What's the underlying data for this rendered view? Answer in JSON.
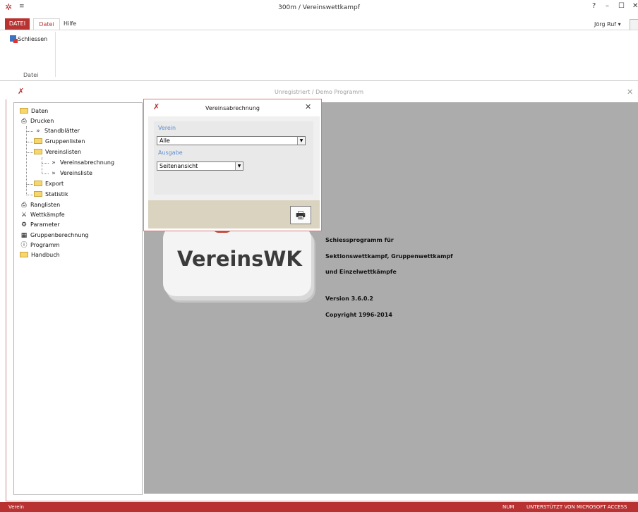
{
  "window": {
    "title": "300m / Vereinswettkampf",
    "controls": {
      "help": "?",
      "minimize": "–",
      "maximize": "☐",
      "close": "✕"
    },
    "qat": "≡"
  },
  "ribbon": {
    "tab_backstage": "DATEI",
    "tab_datei": "Datei",
    "tab_hilfe": "Hilfe",
    "user": "Jörg Ruf ▾",
    "schliessen_label": "Schliessen",
    "group_label": "Datei"
  },
  "document": {
    "status": "Unregistriert  /  Demo Programm",
    "close": "✕"
  },
  "nav": {
    "daten": "Daten",
    "drucken": "Drucken",
    "standblaetter": "Standblätter",
    "gruppenlisten": "Gruppenlisten",
    "vereinslisten": "Vereinslisten",
    "vereinsabrechnung": "Vereinsabrechnung",
    "vereinsliste": "Vereinsliste",
    "export": "Export",
    "statistik": "Statistik",
    "ranglisten": "Ranglisten",
    "wettkaempfe": "Wettkämpfe",
    "parameter": "Parameter",
    "gruppenberechnung": "Gruppenberechnung",
    "programm": "Programm",
    "handbuch": "Handbuch"
  },
  "about": {
    "logo_text": "VereinsWK",
    "line1": "Schiessprogramm für",
    "line2": "Sektionswettkampf, Gruppenwettkampf",
    "line3": "und Einzelwettkämpfe",
    "version": "Version 3.6.0.2",
    "copyright": "Copyright  1996-2014"
  },
  "dialog": {
    "title": "Vereinsabrechnung",
    "close": "✕",
    "verein_label": "Verein",
    "verein_value": "Alle",
    "ausgabe_label": "Ausgabe",
    "ausgabe_value": "Seitenansicht",
    "print_icon": "🖶"
  },
  "statusbar": {
    "left": "Verein",
    "num": "NUM",
    "right": "UNTERSTÜTZT VON MICROSOFT ACCESS"
  }
}
